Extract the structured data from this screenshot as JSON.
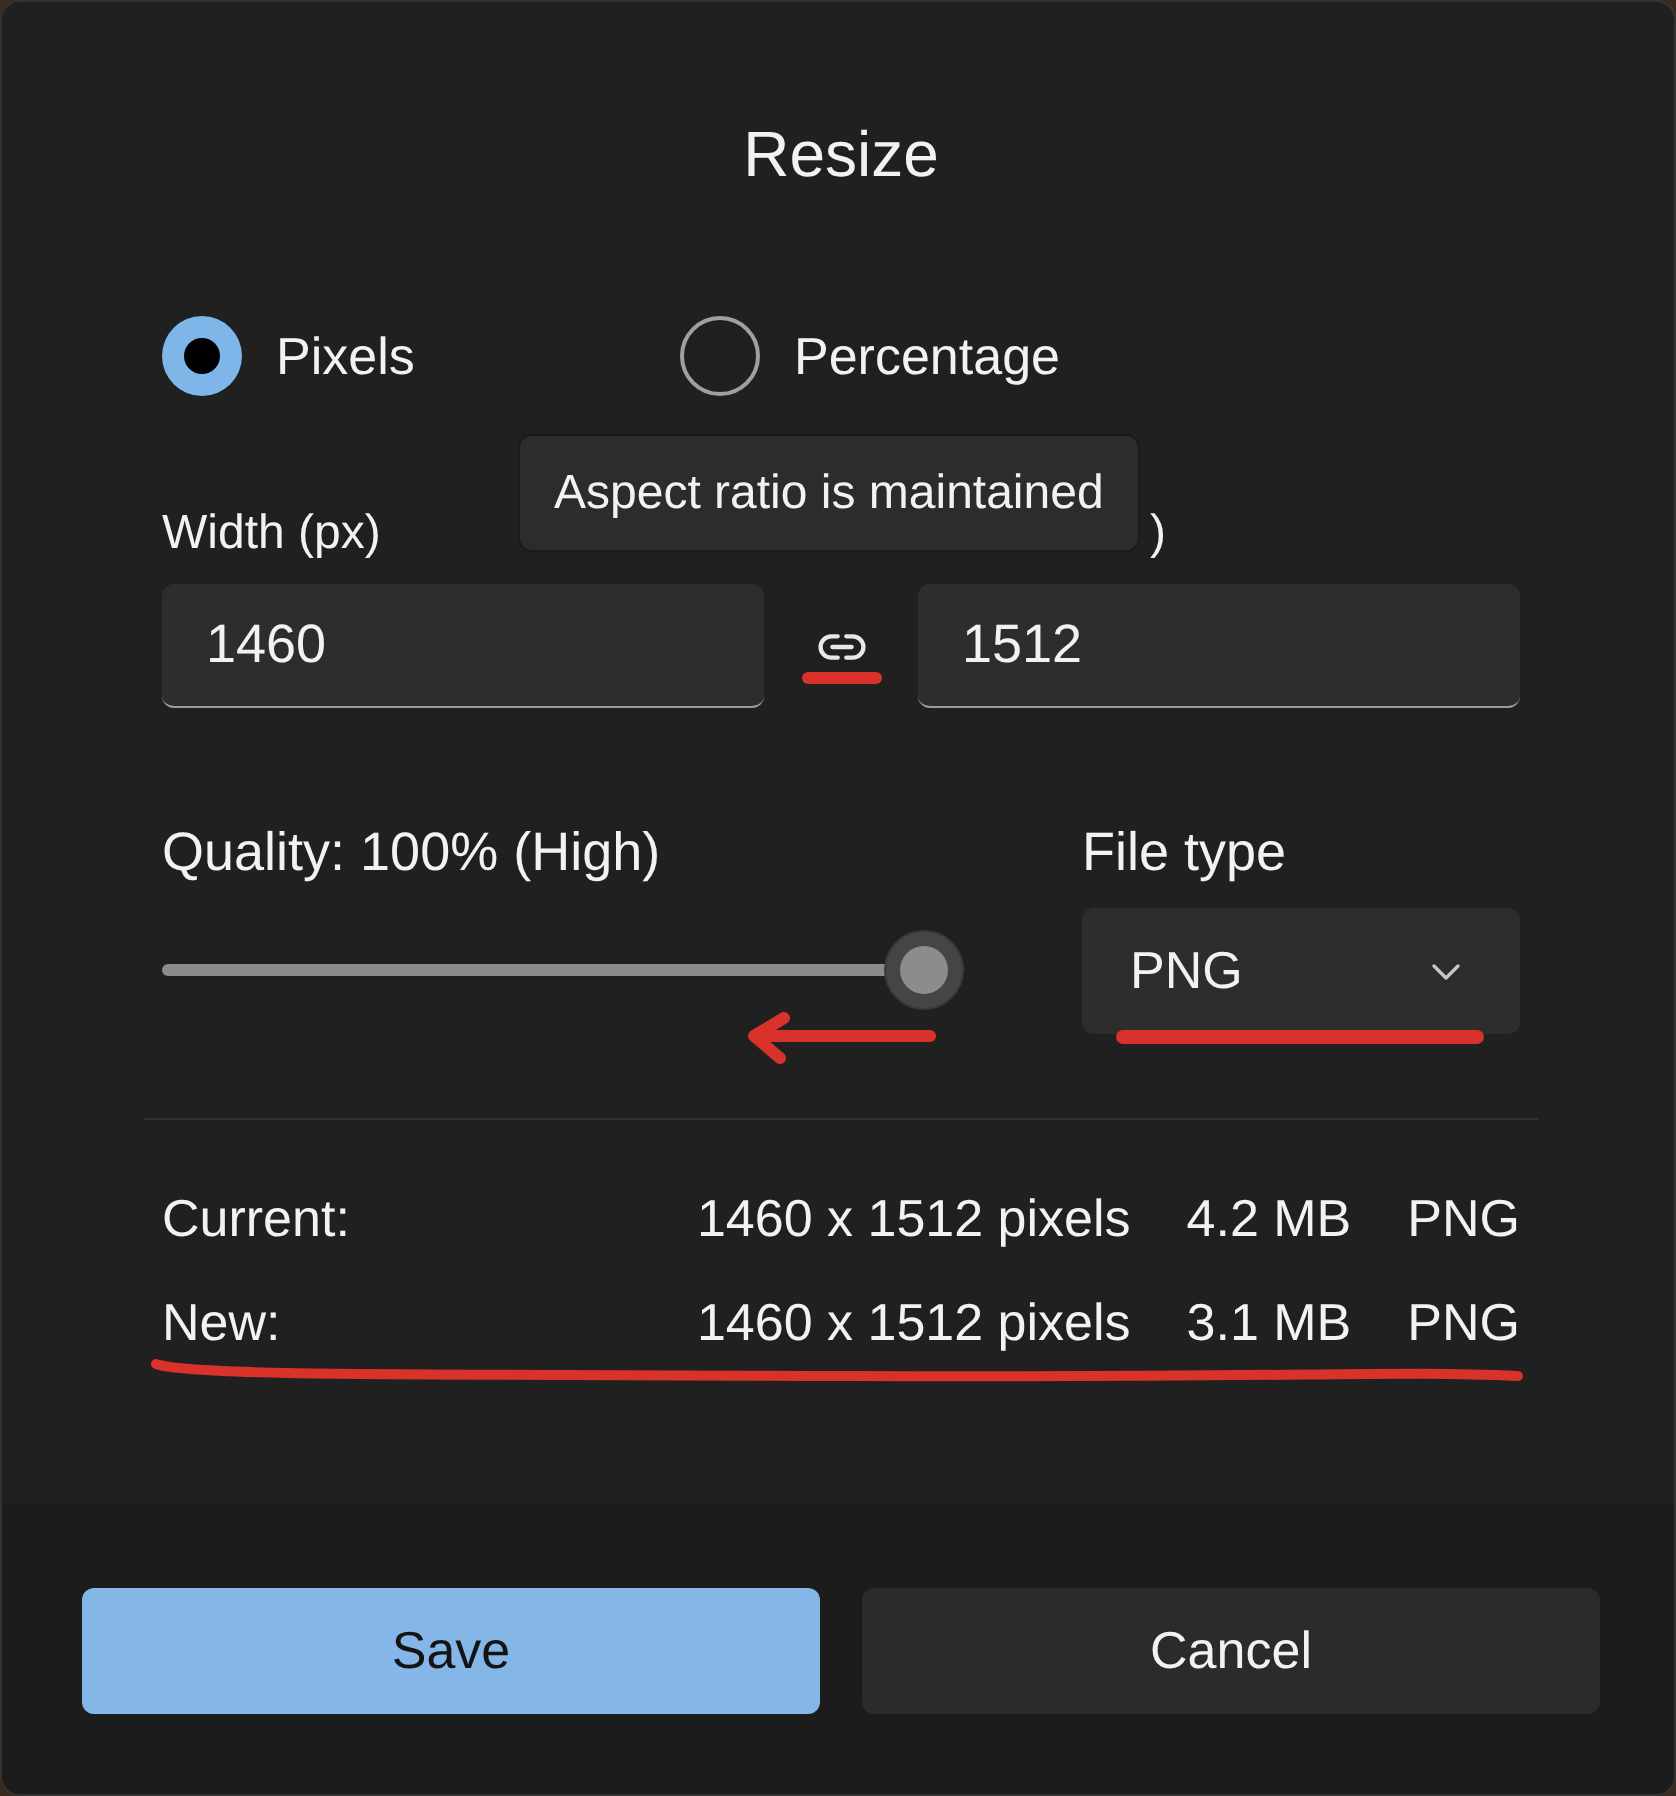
{
  "dialog": {
    "title": "Resize"
  },
  "size_mode": [
    {
      "label": "Pixels",
      "selected": true
    },
    {
      "label": "Percentage",
      "selected": false
    }
  ],
  "tooltip": {
    "text": "Aspect ratio is maintained"
  },
  "width_field": {
    "label": "Width (px)",
    "value": "1460"
  },
  "link_toggle": {
    "underlined": true
  },
  "field_2": {
    "label": ")",
    "value": "1512"
  },
  "quality": {
    "label": "Quality: 100% (High)",
    "level": 1,
    "arrow_marked": true
  },
  "file_type": {
    "label": "File type",
    "value": "PNG",
    "underlined": true
  },
  "summary": [
    {
      "label": "Current:",
      "dimensions": "1460 x 1512 pixels",
      "size": "4.2 MB",
      "format": "PNG"
    },
    {
      "label": "New:",
      "dimensions": "1460 x 1512 pixels",
      "size": "3.1 MB",
      "format": "PNG",
      "underlined": true
    }
  ],
  "buttons": [
    {
      "label": "Save",
      "kind": "primary"
    },
    {
      "label": "Cancel",
      "kind": "secondary"
    }
  ]
}
